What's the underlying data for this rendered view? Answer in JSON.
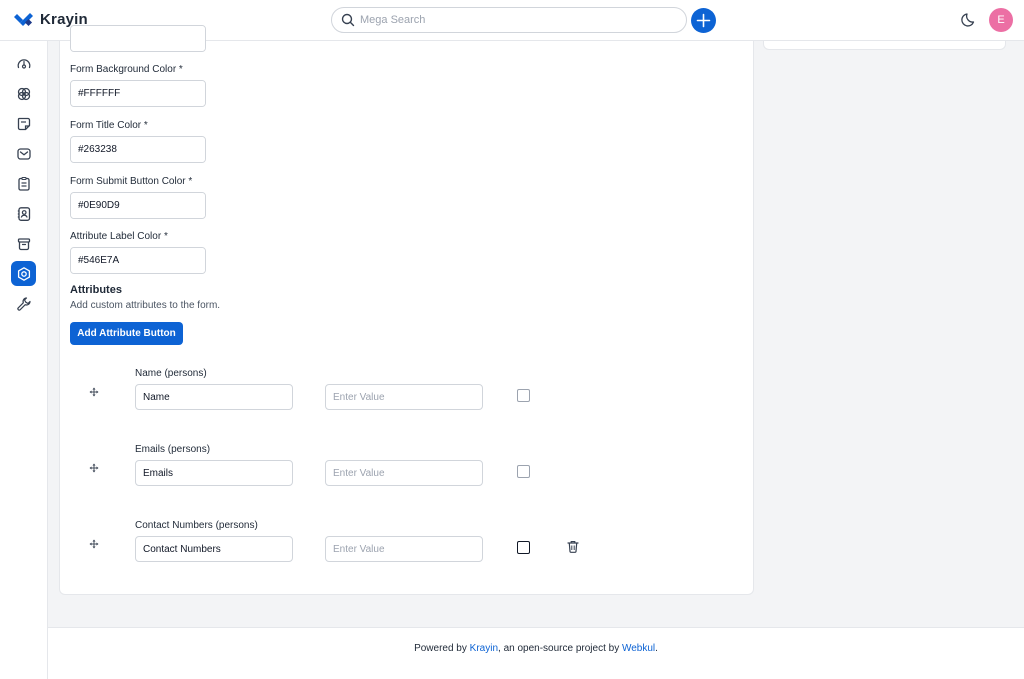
{
  "header": {
    "brand": "Krayin",
    "search_placeholder": "Mega Search",
    "avatar_letter": "E"
  },
  "sidebar": {
    "items": [
      {
        "name": "dashboard",
        "icon": "dashboard-icon"
      },
      {
        "name": "leads",
        "icon": "leads-icon"
      },
      {
        "name": "quotes",
        "icon": "quotes-icon"
      },
      {
        "name": "mail",
        "icon": "mail-icon"
      },
      {
        "name": "activities",
        "icon": "activities-icon"
      },
      {
        "name": "contacts",
        "icon": "contacts-icon"
      },
      {
        "name": "products",
        "icon": "products-icon"
      },
      {
        "name": "settings",
        "icon": "settings-icon",
        "active": true
      },
      {
        "name": "configuration",
        "icon": "wrench-icon"
      }
    ]
  },
  "form": {
    "colors": [
      {
        "label": "",
        "value": "",
        "swatch": "#f3f4f6"
      },
      {
        "label": "Form Background Color *",
        "value": "#FFFFFF",
        "swatch": "#FFFFFF"
      },
      {
        "label": "Form Title Color *",
        "value": "#263238",
        "swatch": "#263238"
      },
      {
        "label": "Form Submit Button Color *",
        "value": "#0E90D9",
        "swatch": "#0E90D9"
      },
      {
        "label": "Attribute Label Color *",
        "value": "#546E7A",
        "swatch": "#546E7A"
      }
    ],
    "attributes_title": "Attributes",
    "attributes_desc": "Add custom attributes to the form.",
    "add_attribute_label": "Add Attribute Button",
    "attributes": [
      {
        "label": "Name (persons)",
        "name": "Name",
        "value_placeholder": "Enter Value",
        "removable": false
      },
      {
        "label": "Emails (persons)",
        "name": "Emails",
        "value_placeholder": "Enter Value",
        "removable": false
      },
      {
        "label": "Contact Numbers (persons)",
        "name": "Contact Numbers",
        "value_placeholder": "Enter Value",
        "removable": true
      }
    ]
  },
  "footer": {
    "prefix": "Powered by ",
    "brand_link": "Krayin",
    "middle": ", an open-source project by ",
    "company_link": "Webkul",
    "suffix": "."
  }
}
